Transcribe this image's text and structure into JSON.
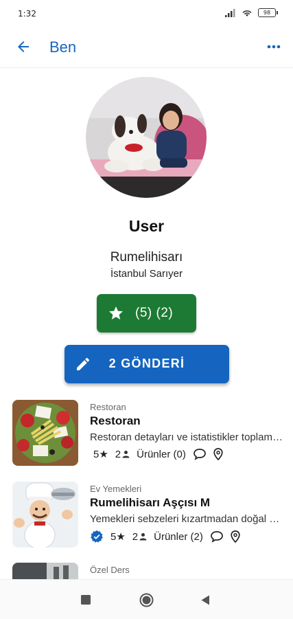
{
  "status_bar": {
    "time": "1:32",
    "battery": "98"
  },
  "app_bar": {
    "title": "Ben"
  },
  "profile": {
    "username": "User",
    "location_line1": "Rumelihisarı",
    "location_line2": "İstanbul Sarıyer",
    "rating_label": "(5) (2)",
    "posts_label": "2 GÖNDERİ"
  },
  "listings": [
    {
      "category": "Restoran",
      "name": "Restoran",
      "description": "Restoran detayları ve istatistikler toplam bilgileri",
      "rating": "5★",
      "followers": "2",
      "products": "Ürünler (0)",
      "verified": false
    },
    {
      "category": "Ev Yemekleri",
      "name": "Rumelihisarı Aşçısı M",
      "description": "Yemekleri sebzeleri kızartmadan doğal olarak",
      "rating": "5★",
      "followers": "2",
      "products": "Ürünler (2)",
      "verified": true
    },
    {
      "category": "Özel Ders",
      "name": "",
      "description": "",
      "rating": "",
      "followers": "",
      "products": "",
      "verified": false
    }
  ],
  "colors": {
    "accent": "#1565c0",
    "rating_green": "#1d7a34"
  }
}
